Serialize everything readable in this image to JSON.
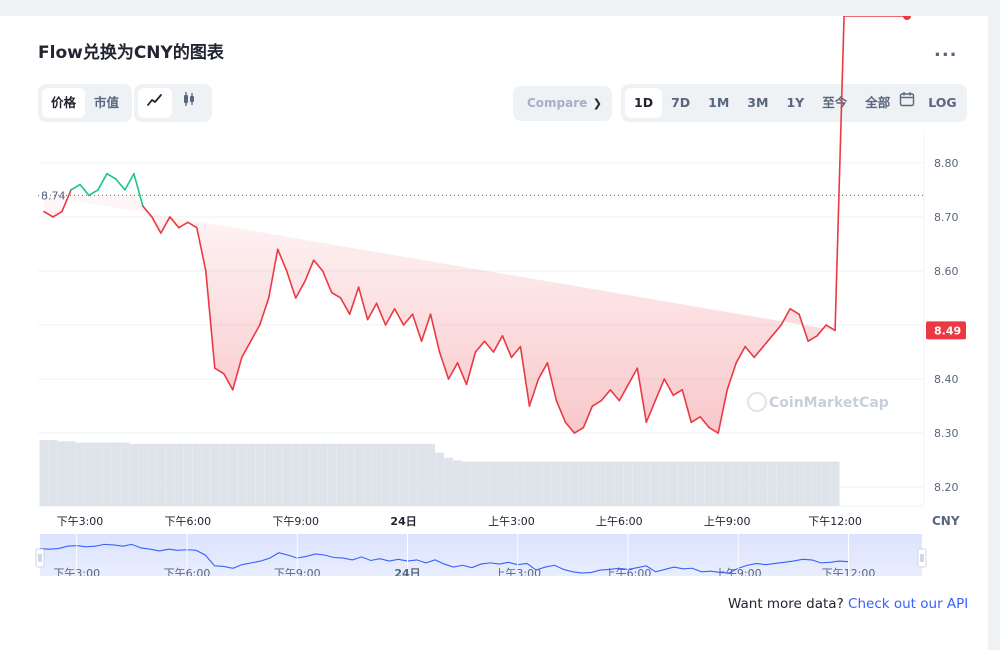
{
  "header": {
    "title": "Flow兑换为CNY的图表",
    "more_label": "..."
  },
  "toolbar": {
    "metric_tabs": [
      {
        "label": "价格",
        "active": true
      },
      {
        "label": "市值",
        "active": false
      }
    ],
    "chart_type_icons": [
      "line-chart-icon",
      "candlestick-icon"
    ],
    "compare_label": "Compare",
    "ranges": [
      {
        "label": "1D",
        "active": true
      },
      {
        "label": "7D",
        "active": false
      },
      {
        "label": "1M",
        "active": false
      },
      {
        "label": "3M",
        "active": false
      },
      {
        "label": "1Y",
        "active": false
      },
      {
        "label": "至今",
        "active": false
      },
      {
        "label": "全部",
        "active": false
      }
    ],
    "calendar_icon": "calendar-icon",
    "log_label": "LOG"
  },
  "colors": {
    "up": "#16c784",
    "down": "#ea3943",
    "accent": "#3861fb",
    "navigator": "#3861fb"
  },
  "chart_data": {
    "type": "line",
    "currency_label": "CNY",
    "open_value": 8.74,
    "open_label": "8.74",
    "current_value": 8.49,
    "current_label": "8.49",
    "y_ticks": [
      "8.80",
      "8.70",
      "8.60",
      "8.40",
      "8.30",
      "8.20"
    ],
    "ylim": [
      8.165,
      8.835
    ],
    "x_ticks": [
      "下午3:00",
      "下午6:00",
      "下午9:00",
      "24日",
      "上午3:00",
      "上午6:00",
      "上午9:00",
      "下午12:00"
    ],
    "x_tick_hours": [
      1,
      4,
      7,
      10,
      13,
      16,
      19,
      22
    ],
    "x_hours": [
      0,
      0.25,
      0.5,
      0.75,
      1,
      1.25,
      1.5,
      1.75,
      2,
      2.25,
      2.5,
      2.75,
      3,
      3.25,
      3.5,
      3.75,
      4,
      4.25,
      4.5,
      4.75,
      5,
      5.25,
      5.5,
      5.75,
      6,
      6.25,
      6.5,
      6.75,
      7,
      7.25,
      7.5,
      7.75,
      8,
      8.25,
      8.5,
      8.75,
      9,
      9.25,
      9.5,
      9.75,
      10,
      10.25,
      10.5,
      10.75,
      11,
      11.25,
      11.5,
      11.75,
      12,
      12.25,
      12.5,
      12.75,
      13,
      13.25,
      13.5,
      13.75,
      14,
      14.25,
      14.5,
      14.75,
      15,
      15.25,
      15.5,
      15.75,
      16,
      16.25,
      16.5,
      16.75,
      17,
      17.25,
      17.5,
      17.75,
      18,
      18.25,
      18.5,
      18.75,
      19,
      19.25,
      19.5,
      19.75,
      20,
      20.25,
      20.5,
      20.75,
      21,
      21.25,
      21.5,
      21.75,
      22,
      22.25,
      22.5,
      22.75,
      23,
      23.25,
      23.5,
      23.75,
      24
    ],
    "prices": [
      8.71,
      8.7,
      8.71,
      8.75,
      8.76,
      8.74,
      8.75,
      8.78,
      8.77,
      8.75,
      8.78,
      8.72,
      8.7,
      8.67,
      8.7,
      8.68,
      8.69,
      8.68,
      8.6,
      8.42,
      8.41,
      8.38,
      8.44,
      8.47,
      8.5,
      8.55,
      8.64,
      8.6,
      8.55,
      8.58,
      8.62,
      8.6,
      8.56,
      8.55,
      8.52,
      8.57,
      8.51,
      8.54,
      8.5,
      8.53,
      8.5,
      8.52,
      8.47,
      8.52,
      8.45,
      8.4,
      8.43,
      8.39,
      8.45,
      8.47,
      8.45,
      8.48,
      8.44,
      8.46,
      8.35,
      8.4,
      8.43,
      8.36,
      8.32,
      8.3,
      8.31,
      8.35,
      8.36,
      8.38,
      8.36,
      8.39,
      8.42,
      8.32,
      8.36,
      8.4,
      8.37,
      8.38,
      8.32,
      8.33,
      8.31,
      8.3,
      8.38,
      8.43,
      8.46,
      8.44,
      8.46,
      8.48,
      8.5,
      8.53,
      8.52,
      8.47,
      8.48,
      8.5,
      8.49
    ],
    "volumes": [
      0.52,
      0.52,
      0.51,
      0.51,
      0.5,
      0.5,
      0.5,
      0.5,
      0.5,
      0.5,
      0.49,
      0.49,
      0.49,
      0.49,
      0.49,
      0.49,
      0.49,
      0.49,
      0.49,
      0.49,
      0.49,
      0.49,
      0.49,
      0.49,
      0.49,
      0.49,
      0.49,
      0.49,
      0.49,
      0.49,
      0.49,
      0.49,
      0.49,
      0.49,
      0.49,
      0.49,
      0.49,
      0.49,
      0.49,
      0.49,
      0.49,
      0.49,
      0.49,
      0.49,
      0.42,
      0.38,
      0.36,
      0.35,
      0.35,
      0.35,
      0.35,
      0.35,
      0.35,
      0.35,
      0.35,
      0.35,
      0.35,
      0.35,
      0.35,
      0.35,
      0.35,
      0.35,
      0.35,
      0.35,
      0.35,
      0.35,
      0.35,
      0.35,
      0.35,
      0.35,
      0.35,
      0.35,
      0.35,
      0.35,
      0.35,
      0.35,
      0.35,
      0.35,
      0.35,
      0.35,
      0.35,
      0.35,
      0.35,
      0.35,
      0.35,
      0.35,
      0.35,
      0.35,
      0.35
    ],
    "navigator_ticks": [
      "下午3:00",
      "下午6:00",
      "下午9:00",
      "24日",
      "上午3:00",
      "上午6:00",
      "上午9:00",
      "下午12:00"
    ],
    "watermark": "CoinMarketCap",
    "grid": true,
    "legend": "none"
  },
  "footer": {
    "api_prefix": "Want more data?",
    "api_link": "Check out our API"
  }
}
